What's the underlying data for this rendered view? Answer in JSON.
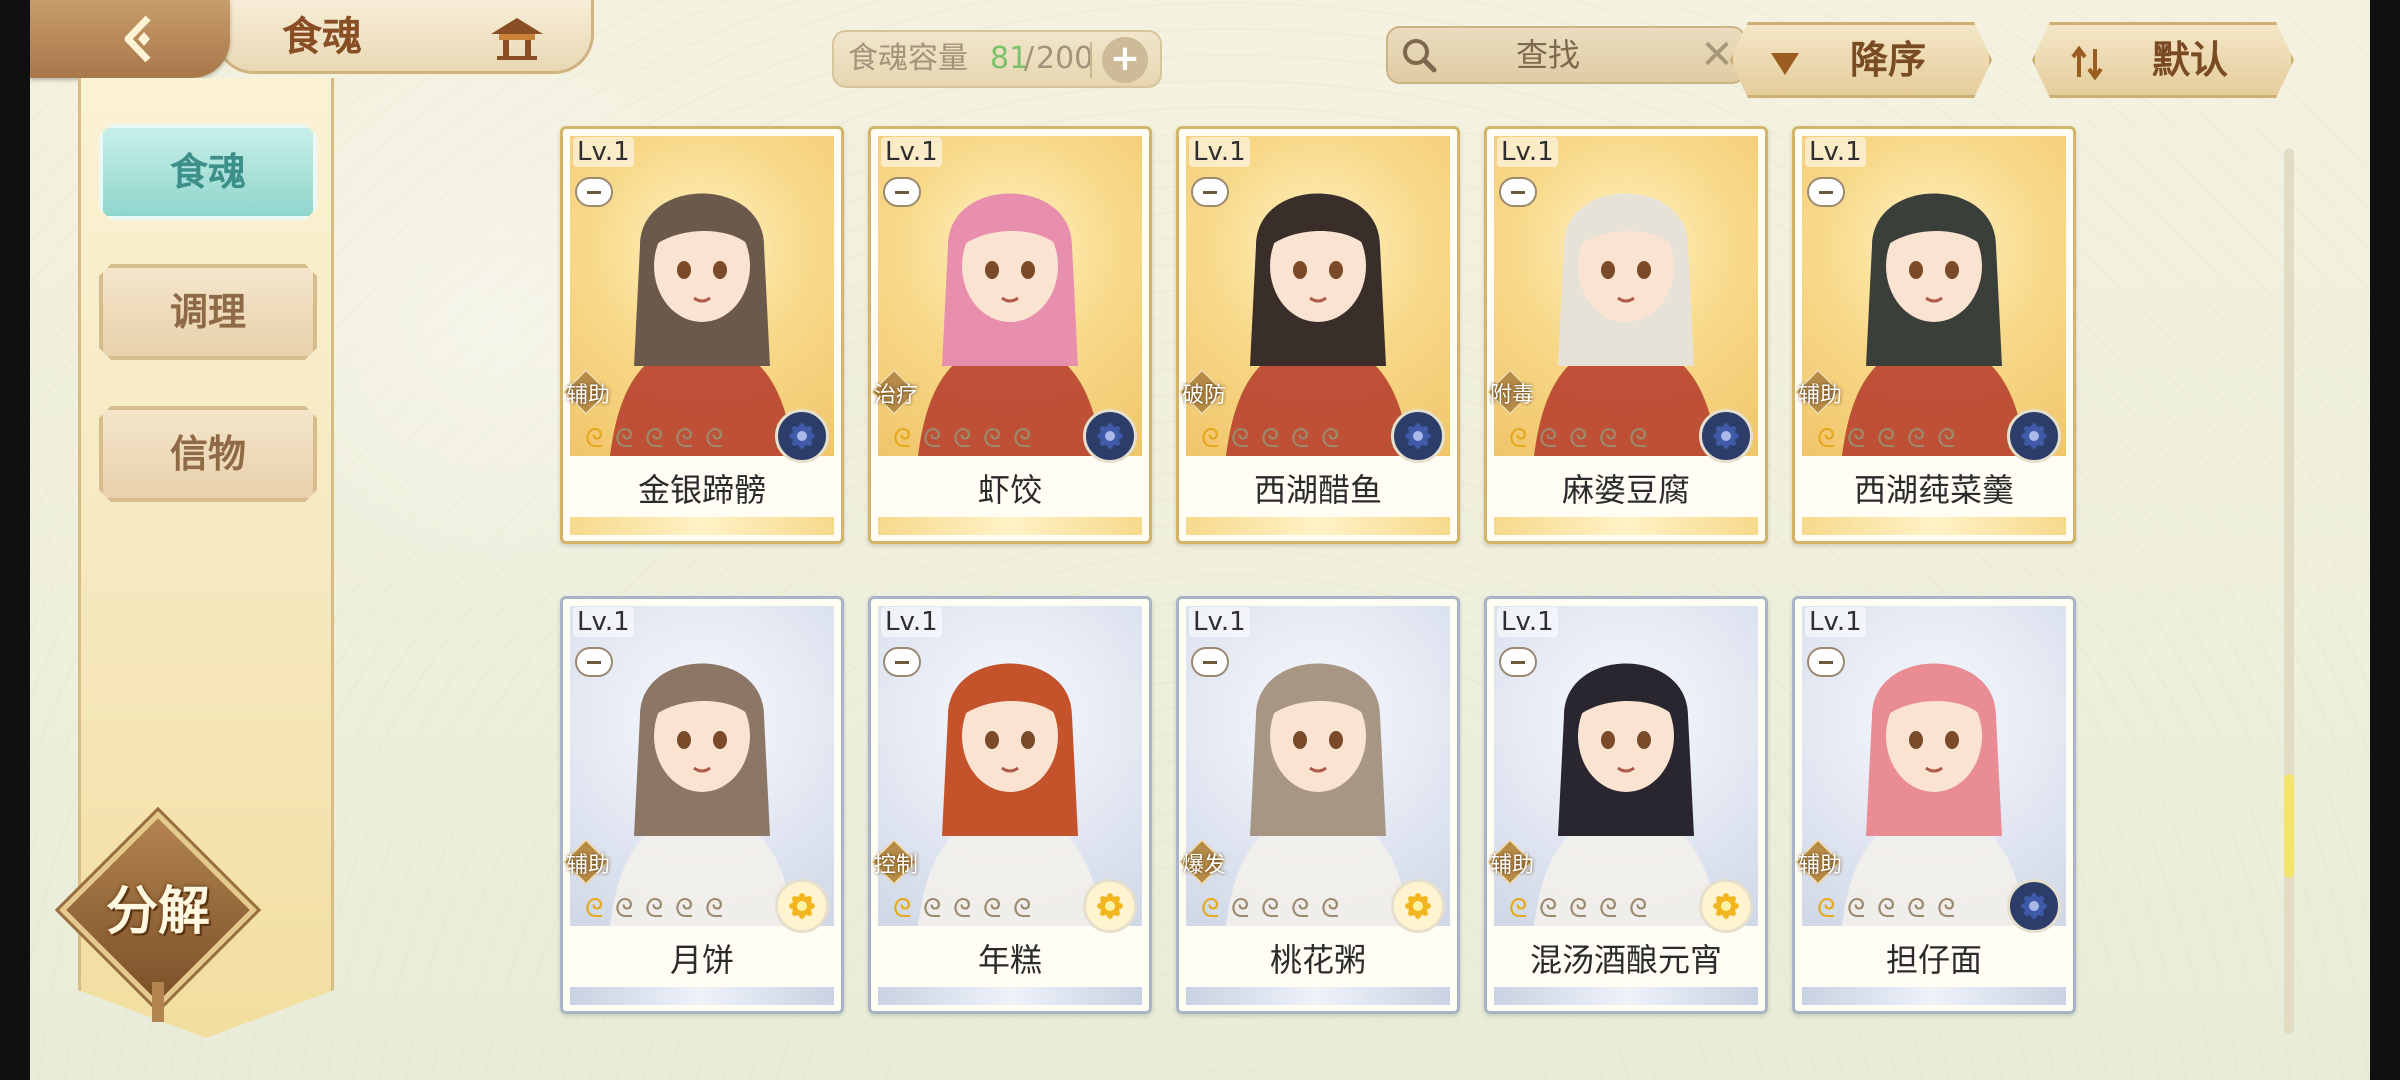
{
  "header": {
    "title": "食魂",
    "capacity_label": "食魂容量",
    "capacity_current": "81",
    "capacity_sep": "/",
    "capacity_max": "200",
    "capacity_plus": "+",
    "search_placeholder": "查找",
    "search_clear": "✕",
    "sort_order_label": "降序",
    "sort_default_label": "默认"
  },
  "sidebar": {
    "items": [
      {
        "label": "食魂",
        "active": true
      },
      {
        "label": "调理",
        "active": false
      },
      {
        "label": "信物",
        "active": false
      }
    ],
    "decompose_label": "分解"
  },
  "cards": [
    {
      "level": "Lv.1",
      "role": "辅助",
      "name": "金银蹄髈",
      "rarity": "gold",
      "element": "blue-flower",
      "stars_on": 1,
      "stars_total": 5
    },
    {
      "level": "Lv.1",
      "role": "治疗",
      "name": "虾饺",
      "rarity": "gold",
      "element": "blue-flower",
      "stars_on": 1,
      "stars_total": 5
    },
    {
      "level": "Lv.1",
      "role": "破防",
      "name": "西湖醋鱼",
      "rarity": "gold",
      "element": "blue-flower",
      "stars_on": 1,
      "stars_total": 5
    },
    {
      "level": "Lv.1",
      "role": "附毒",
      "name": "麻婆豆腐",
      "rarity": "gold",
      "element": "blue-flower",
      "stars_on": 1,
      "stars_total": 5
    },
    {
      "level": "Lv.1",
      "role": "辅助",
      "name": "西湖莼菜羹",
      "rarity": "gold",
      "element": "blue-flower",
      "stars_on": 1,
      "stars_total": 5
    },
    {
      "level": "Lv.1",
      "role": "辅助",
      "name": "月饼",
      "rarity": "silver",
      "element": "gold-flower",
      "stars_on": 1,
      "stars_total": 5
    },
    {
      "level": "Lv.1",
      "role": "控制",
      "name": "年糕",
      "rarity": "silver",
      "element": "gold-flower",
      "stars_on": 1,
      "stars_total": 5
    },
    {
      "level": "Lv.1",
      "role": "爆发",
      "name": "桃花粥",
      "rarity": "silver",
      "element": "gold-flower",
      "stars_on": 1,
      "stars_total": 5
    },
    {
      "level": "Lv.1",
      "role": "辅助",
      "name": "混汤酒酿元宵",
      "rarity": "silver",
      "element": "gold-flower",
      "stars_on": 1,
      "stars_total": 5
    },
    {
      "level": "Lv.1",
      "role": "辅助",
      "name": "担仔面",
      "rarity": "silver",
      "element": "blue-flower",
      "stars_on": 1,
      "stars_total": 5
    }
  ],
  "colors": {
    "accent_brown": "#8a4e24",
    "capacity_green": "#7bc26a",
    "active_tab": "#8fd6cc",
    "gold_frame": "#d3b46b",
    "silver_frame": "#a9b4c6"
  }
}
